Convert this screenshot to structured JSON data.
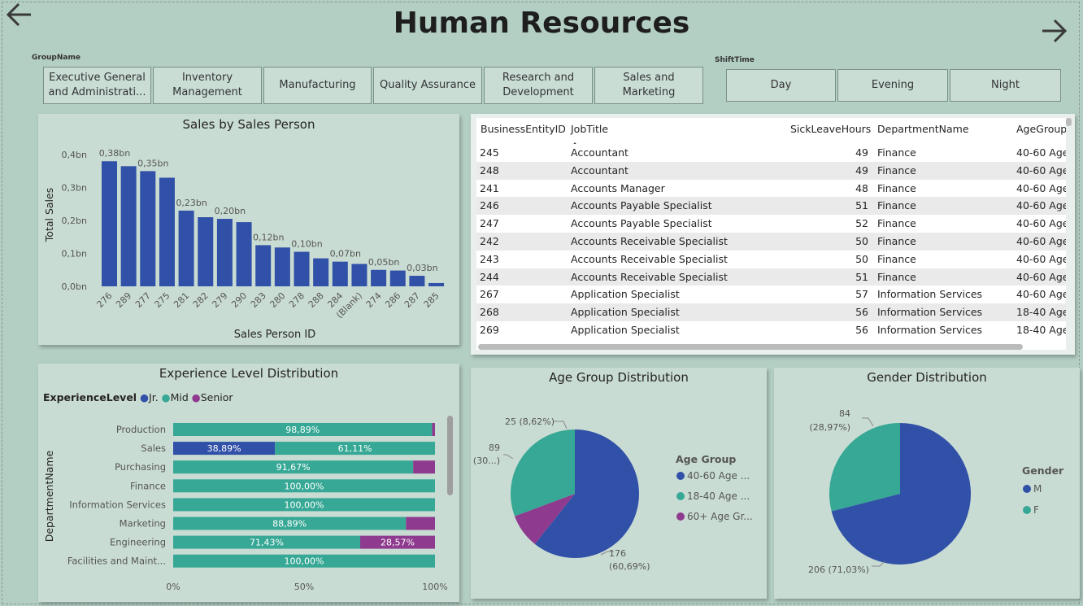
{
  "page": {
    "title": "Human Resources"
  },
  "nav": {
    "back_icon": "arrow-left-icon",
    "forward_icon": "arrow-right-icon"
  },
  "group_slicer": {
    "label": "GroupName",
    "items": [
      "Executive General\nand Administrati...",
      "Inventory\nManagement",
      "Manufacturing",
      "Quality Assurance",
      "Research and\nDevelopment",
      "Sales and\nMarketing"
    ]
  },
  "shift_slicer": {
    "label": "ShiftTime",
    "items": [
      "Day",
      "Evening",
      "Night"
    ]
  },
  "colors": {
    "blue": "#3150a8",
    "teal": "#36a895",
    "purple": "#8e3b8f"
  },
  "employee_table": {
    "columns": [
      "BusinessEntityID",
      "JobTitle",
      "SickLeaveHours",
      "DepartmentName",
      "AgeGroup"
    ],
    "sort_column": "JobTitle",
    "rows": [
      [
        "245",
        "Accountant",
        "49",
        "Finance",
        "40-60 Age"
      ],
      [
        "248",
        "Accountant",
        "49",
        "Finance",
        "40-60 Age"
      ],
      [
        "241",
        "Accounts Manager",
        "48",
        "Finance",
        "40-60 Age"
      ],
      [
        "246",
        "Accounts Payable Specialist",
        "51",
        "Finance",
        "40-60 Age"
      ],
      [
        "247",
        "Accounts Payable Specialist",
        "52",
        "Finance",
        "40-60 Age"
      ],
      [
        "242",
        "Accounts Receivable Specialist",
        "50",
        "Finance",
        "40-60 Age"
      ],
      [
        "243",
        "Accounts Receivable Specialist",
        "50",
        "Finance",
        "40-60 Age"
      ],
      [
        "244",
        "Accounts Receivable Specialist",
        "51",
        "Finance",
        "40-60 Age"
      ],
      [
        "267",
        "Application Specialist",
        "57",
        "Information Services",
        "40-60 Age"
      ],
      [
        "268",
        "Application Specialist",
        "56",
        "Information Services",
        "18-40 Age"
      ],
      [
        "269",
        "Application Specialist",
        "56",
        "Information Services",
        "18-40 Age"
      ]
    ]
  },
  "chart_data": [
    {
      "type": "bar",
      "title": "Sales by Sales Person",
      "xlabel": "Sales Person ID",
      "ylabel": "Total Sales",
      "categories": [
        "276",
        "289",
        "277",
        "275",
        "281",
        "282",
        "279",
        "290",
        "283",
        "280",
        "278",
        "288",
        "284",
        "(Blank)",
        "274",
        "286",
        "287",
        "285"
      ],
      "values": [
        0.38,
        0.365,
        0.35,
        0.33,
        0.23,
        0.21,
        0.205,
        0.195,
        0.125,
        0.118,
        0.105,
        0.085,
        0.075,
        0.068,
        0.05,
        0.048,
        0.032,
        0.01
      ],
      "data_labels": {
        "0": "0,38bn",
        "2": "0,35bn",
        "4": "0,23bn",
        "6": "0,20bn",
        "8": "0,12bn",
        "10": "0,10bn",
        "12": "0,07bn",
        "14": "0,05bn",
        "16": "0,03bn"
      },
      "yticks": [
        0,
        0.1,
        0.2,
        0.3,
        0.4
      ],
      "ytick_labels": [
        "0,0bn",
        "0,1bn",
        "0,2bn",
        "0,3bn",
        "0,4bn"
      ],
      "ylim": [
        0,
        0.43
      ],
      "grid": false
    },
    {
      "type": "bar",
      "orientation": "horizontal",
      "stacked": "100%",
      "title": "Experience Level Distribution",
      "ylabel": "DepartmentName",
      "legend_title": "ExperienceLevel",
      "legend_position": "top-left",
      "categories": [
        "Production",
        "Sales",
        "Purchasing",
        "Finance",
        "Information Services",
        "Marketing",
        "Engineering",
        "Facilities and Maint..."
      ],
      "series": [
        {
          "name": "Jr.",
          "values": [
            0,
            38.89,
            0,
            0,
            0,
            0,
            0,
            0
          ],
          "labels": [
            "",
            "38,89%",
            "",
            "",
            "",
            "",
            "",
            ""
          ]
        },
        {
          "name": "Mid",
          "values": [
            98.89,
            61.11,
            91.67,
            100,
            100,
            88.89,
            71.43,
            100
          ],
          "labels": [
            "98,89%",
            "61,11%",
            "91,67%",
            "100,00%",
            "100,00%",
            "88,89%",
            "71,43%",
            "100,00%"
          ]
        },
        {
          "name": "Senior",
          "values": [
            1.11,
            0,
            8.33,
            0,
            0,
            11.11,
            28.57,
            0
          ],
          "labels": [
            "",
            "",
            "",
            "",
            "",
            "",
            "28,57%",
            ""
          ]
        }
      ],
      "xticks": [
        "0%",
        "50%",
        "100%"
      ]
    },
    {
      "type": "pie",
      "title": "Age Group Distribution",
      "legend_title": "Age Group",
      "legend_position": "right",
      "slices": [
        {
          "name": "40-60 Age ...",
          "value": 176,
          "percent": 60.69,
          "label": [
            "176",
            "(60,69%)"
          ]
        },
        {
          "name": "18-40 Age ...",
          "value": 89,
          "percent": 30.69,
          "label": [
            "89",
            "(30...)"
          ]
        },
        {
          "name": "60+ Age Gr...",
          "value": 25,
          "percent": 8.62,
          "label": [
            "25 (8,62%)"
          ]
        }
      ]
    },
    {
      "type": "pie",
      "title": "Gender Distribution",
      "legend_title": "Gender",
      "legend_position": "right",
      "slices": [
        {
          "name": "M",
          "value": 206,
          "percent": 71.03,
          "label": [
            "206 (71,03%)"
          ]
        },
        {
          "name": "F",
          "value": 84,
          "percent": 28.97,
          "label": [
            "84",
            "(28,97%)"
          ]
        }
      ]
    }
  ]
}
